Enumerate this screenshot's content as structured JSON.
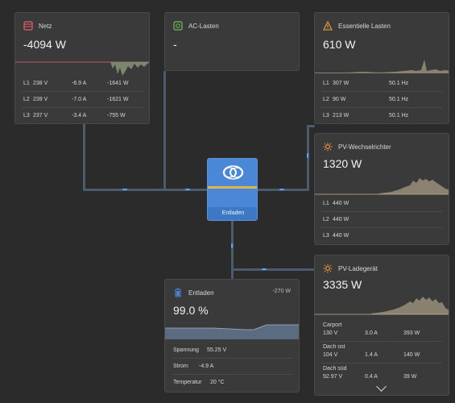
{
  "netz": {
    "title": "Netz",
    "value": "-4094 W",
    "rows": [
      {
        "phase": "L1",
        "v": "238 V",
        "a": "-6.9 A",
        "w": "-1641 W"
      },
      {
        "phase": "L2",
        "v": "239 V",
        "a": "-7.0 A",
        "w": "-1621 W"
      },
      {
        "phase": "L3",
        "v": "237 V",
        "a": "-3.4 A",
        "w": "-755 W"
      }
    ],
    "icon": "grid-icon",
    "accent": "#e35d6a"
  },
  "ac_lasten": {
    "title": "AC-Lasten",
    "value": "-",
    "icon": "ac-load-icon",
    "accent": "#6dbf58"
  },
  "essentielle": {
    "title": "Essentielle Lasten",
    "value": "610 W",
    "rows": [
      {
        "phase": "L1",
        "w": "307 W",
        "hz": "50.1 Hz"
      },
      {
        "phase": "L2",
        "w": "90 W",
        "hz": "50.1 Hz"
      },
      {
        "phase": "L3",
        "w": "213 W",
        "hz": "50.1 Hz"
      }
    ],
    "icon": "warning-icon",
    "accent": "#f2a23a"
  },
  "pv_wechselrichter": {
    "title": "PV-Wechselrichter",
    "value": "1320 W",
    "rows": [
      {
        "phase": "L1",
        "w": "440 W"
      },
      {
        "phase": "L2",
        "w": "440 W"
      },
      {
        "phase": "L3",
        "w": "440 W"
      }
    ],
    "icon": "sun-icon",
    "accent": "#f2a23a"
  },
  "center": {
    "status": "Entladen",
    "icon": "victron-logo",
    "accent": "#4a87d6"
  },
  "battery": {
    "title": "Entladen",
    "power": "-270 W",
    "soc": "99.0 %",
    "rows": [
      {
        "label": "Spannung",
        "value": "55.25 V"
      },
      {
        "label": "Strom",
        "value": "-4.9 A"
      },
      {
        "label": "Temperatur",
        "value": "20 °C"
      }
    ],
    "icon": "battery-icon",
    "accent": "#4a87d6"
  },
  "pv_lader": {
    "title": "PV-Ladegerät",
    "value": "3335 W",
    "rows": [
      {
        "name": "Carport",
        "v": "130 V",
        "a": "3.0 A",
        "w": "393 W"
      },
      {
        "name": "Dach ost",
        "v": "104 V",
        "a": "1.4 A",
        "w": "140 W"
      },
      {
        "name": "Dach süd",
        "v": "92.97 V",
        "a": "0.4 A",
        "w": "39 W"
      }
    ],
    "icon": "sun-icon",
    "accent": "#f2a23a"
  }
}
